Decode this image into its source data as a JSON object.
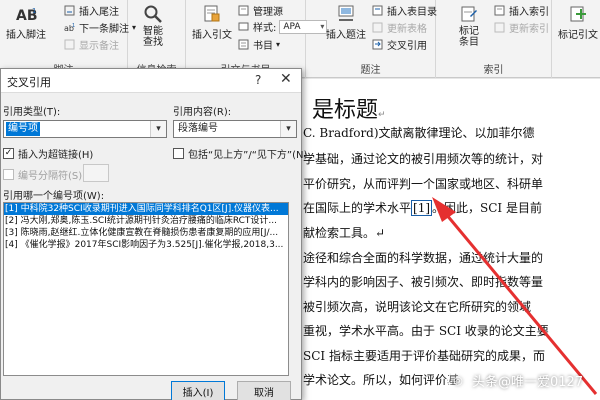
{
  "ribbon": {
    "footnotes": {
      "insert_footnote": "插入脚注",
      "insert_endnote": "插入尾注",
      "next_footnote": "下一条脚注",
      "show_notes": "显示备注",
      "group_label": "脚注"
    },
    "research": {
      "smart_lookup": "智能\n查找",
      "group_label": "信息检索"
    },
    "citations": {
      "insert_citation": "插入引文",
      "manage_sources": "管理源",
      "style_label": "样式:",
      "style_value": "APA",
      "bibliography": "书目",
      "group_label": "引文与书目"
    },
    "captions": {
      "insert_caption": "插入题注",
      "insert_table_of_figures": "插入表目录",
      "update_table": "更新表格",
      "cross_reference": "交叉引用",
      "group_label": "题注"
    },
    "index": {
      "mark_entry": "标记\n条目",
      "insert_index": "插入索引",
      "update_index": "更新索引",
      "group_label": "索引"
    },
    "toa": {
      "mark_citation": "标记引文"
    }
  },
  "dialog": {
    "title": "交叉引用",
    "help": "?",
    "close": "✕",
    "reference_type_label": "引用类型(T):",
    "reference_type_value": "编号项",
    "insert_reference_to_label": "引用内容(R):",
    "insert_reference_to_value": "段落编号",
    "insert_as_hyperlink": "插入为超链接(H)",
    "include_above_below": "包括“见上方”/“见下方”(N)",
    "separate_numbers": "编号分隔符(S)",
    "for_which_label": "引用哪一个编号项(W):",
    "items": [
      "[1] 中科院32种SCI收录期刊进入国际同学科排名Q1区[J].仪器仪表...",
      "[2] 冯大刚,郑奥,陈玉.SCI统计源期刊针灸治疗腰痛的临床RCT设计...",
      "[3] 陈晓雨,赵继红.立体化健康宣教在脊髓损伤患者康复期的应用[J/...",
      "[4] 《催化学报》2017年SCI影响因子为3.525[J].催化学报,2018,3..."
    ],
    "insert_button": "插入(I)",
    "cancel_button": "取消"
  },
  "document": {
    "heading": "是标题",
    "lines": [
      "C.  Bradford)文献离散律理论、以加菲尔德",
      "学基础，通过论文的被引用频次等的统计，对",
      "平价研究，从而评判一个国家或地区、科研单",
      "在国际上的学术水平",
      "。因此，SCI 是目前",
      "献检索工具。↵",
      "途径和综合全面的科学数据，通过统计大量的",
      "学科内的影响因子、被引频次、即时指数等量",
      "被引频次高，说明该论文在它所研究的领域",
      "重视，学术水平高。由于 SCI 收录的论文主要",
      "SCI 指标主要适用于评价基础研究的成果，而",
      "学术论文。所以，如何评价基"
    ],
    "citation_marker": "[1]"
  },
  "watermark": {
    "text": "头条@唯一爱0127"
  }
}
